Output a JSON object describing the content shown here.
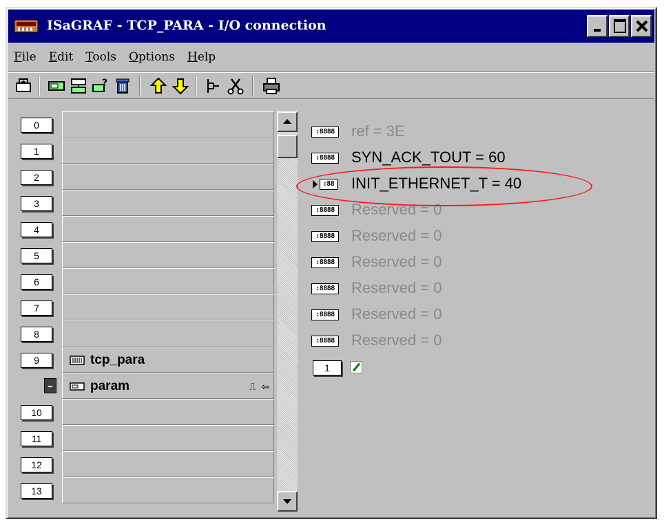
{
  "window": {
    "title": "ISaGRAF - TCP_PARA - I/O connection",
    "icon": "isagraf-app-icon"
  },
  "menu": [
    {
      "accel": "F",
      "rest": "ile"
    },
    {
      "accel": "E",
      "rest": "dit"
    },
    {
      "accel": "T",
      "rest": "ools"
    },
    {
      "accel": "O",
      "rest": "ptions"
    },
    {
      "accel": "H",
      "rest": "elp"
    }
  ],
  "toolbar": {
    "icons": [
      "board-icon",
      "variable-icon",
      "set-parameters-icon",
      "board-param-icon",
      "delete-icon",
      "move-up-icon",
      "move-down-icon",
      "connect-icon",
      "cut-icon",
      "print-icon"
    ]
  },
  "slots": [
    {
      "num": "0",
      "name": ""
    },
    {
      "num": "1",
      "name": ""
    },
    {
      "num": "2",
      "name": ""
    },
    {
      "num": "3",
      "name": ""
    },
    {
      "num": "4",
      "name": ""
    },
    {
      "num": "5",
      "name": ""
    },
    {
      "num": "6",
      "name": ""
    },
    {
      "num": "7",
      "name": ""
    },
    {
      "num": "8",
      "name": ""
    },
    {
      "num": "9",
      "name": "tcp_para",
      "icon": "complex-board-icon"
    },
    {
      "num": "",
      "name": "param",
      "icon": "board-param-icon",
      "sub": true,
      "signals": "⎍ ⇦"
    },
    {
      "num": "10",
      "name": ""
    },
    {
      "num": "11",
      "name": ""
    },
    {
      "num": "12",
      "name": ""
    },
    {
      "num": "13",
      "name": ""
    }
  ],
  "channels": [
    {
      "label": "ref = 3E",
      "state": "grey",
      "icon_text": ":8888"
    },
    {
      "label": "SYN_ACK_TOUT = 60",
      "state": "black",
      "icon_text": ":8888"
    },
    {
      "label": "INIT_ETHERNET_T = 40",
      "state": "black",
      "icon_text": ":88",
      "selected": true,
      "highlighted": true
    },
    {
      "label": "Reserved = 0",
      "state": "grey",
      "icon_text": ":8888"
    },
    {
      "label": "Reserved = 0",
      "state": "grey",
      "icon_text": ":8888"
    },
    {
      "label": "Reserved = 0",
      "state": "grey",
      "icon_text": ":8888"
    },
    {
      "label": "Reserved = 0",
      "state": "grey",
      "icon_text": ":8888"
    },
    {
      "label": "Reserved = 0",
      "state": "grey",
      "icon_text": ":8888"
    },
    {
      "label": "Reserved = 0",
      "state": "grey",
      "icon_text": ":8888"
    }
  ],
  "channel_page": {
    "num": "1",
    "icon": "edit-pencil-icon"
  },
  "colors": {
    "titlebar": "#000080",
    "face": "#c0c0c0",
    "highlight_oval": "#ff1a1a",
    "disabled_text": "#8a8a8a"
  }
}
